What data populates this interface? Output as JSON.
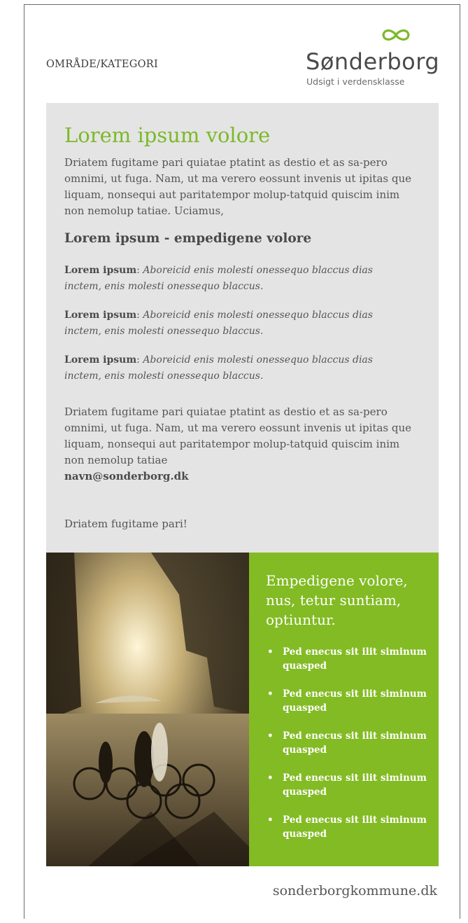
{
  "header": {
    "category": "OMRÅDE/KATEGORI",
    "logo": {
      "name": "Sønderborg",
      "tagline": "Udsigt i verdensklasse"
    }
  },
  "content": {
    "headline": "Lorem ipsum volore",
    "intro": "Driatem fugitame pari quiatae ptatint as destio et as sa-pero omnimi, ut fuga. Nam, ut ma verero eossunt invenis ut ipitas que liquam, nonsequi aut paritatempor molup-tatquid quiscim inim non nemolup tatiae. Uciamus,",
    "subheading": "Lorem ipsum - empedigene volore",
    "details": [
      {
        "label": "Lorem ipsum",
        "separator": ": ",
        "text": "Aboreicid enis molesti onessequo blaccus dias inctem, enis molesti onessequo blaccus."
      },
      {
        "label": "Lorem ipsum",
        "separator": ": ",
        "text": "Aboreicid enis molesti onessequo blaccus dias inctem, enis molesti onessequo blaccus."
      },
      {
        "label": "Lorem ipsum",
        "separator": ": ",
        "text": "Aboreicid enis molesti onessequo blaccus dias inctem, enis molesti onessequo blaccus."
      }
    ],
    "outro": "Driatem fugitame pari quiatae ptatint as destio et as sa-pero omnimi, ut fuga. Nam, ut ma verero eossunt invenis ut ipitas que liquam, nonsequi aut paritatempor molup-tatquid quiscim inim non nemolup tatiae",
    "email": "navn@sonderborg.dk",
    "closing": "Driatem fugitame pari!"
  },
  "highlight": {
    "title": "Empedigene volore, nus, tetur suntiam, optiuntur.",
    "bullets": [
      "Ped enecus sit ilit siminum quasped",
      "Ped enecus sit ilit siminum quasped",
      "Ped enecus sit ilit siminum quasped",
      "Ped enecus sit ilit siminum quasped",
      "Ped enecus sit ilit siminum quasped"
    ],
    "bullet_symbol": "•"
  },
  "footer": {
    "website": "sonderborgkommune.dk"
  },
  "colors": {
    "accent_green": "#82bb23",
    "headline_green": "#7cb92a",
    "panel_grey": "#e4e4e4",
    "text_grey": "#555555"
  },
  "icons": {
    "logo_mark": "infinity-icon"
  }
}
